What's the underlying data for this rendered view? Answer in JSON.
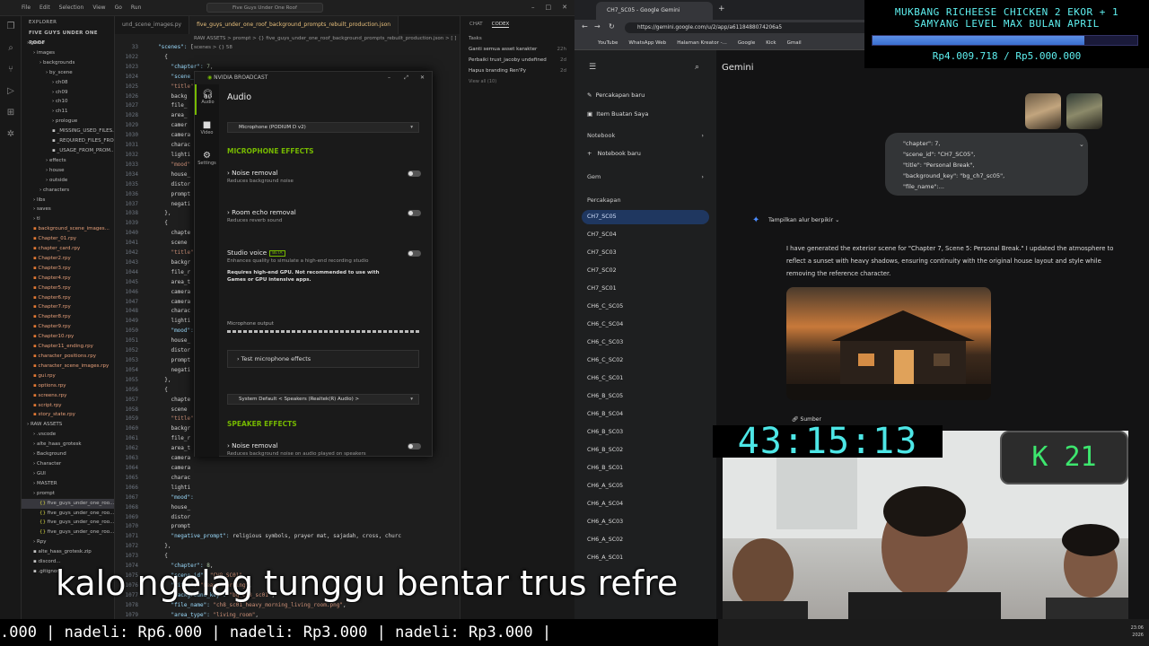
{
  "vscode": {
    "title_search": "Five Guys Under One Roof",
    "menu": [
      "File",
      "Edit",
      "Selection",
      "View",
      "Go",
      "Run"
    ],
    "explorer_header": "EXPLORER",
    "project": "FIVE GUYS UNDER ONE ROOF",
    "tree": [
      {
        "label": "game",
        "indent": 0,
        "kind": "folder"
      },
      {
        "label": "images",
        "indent": 1,
        "kind": "folder"
      },
      {
        "label": "backgrounds",
        "indent": 2,
        "kind": "folder"
      },
      {
        "label": "by_scene",
        "indent": 3,
        "kind": "folder"
      },
      {
        "label": "ch08",
        "indent": 4,
        "kind": "folder"
      },
      {
        "label": "ch09",
        "indent": 4,
        "kind": "folder"
      },
      {
        "label": "ch10",
        "indent": 4,
        "kind": "folder"
      },
      {
        "label": "ch11",
        "indent": 4,
        "kind": "folder"
      },
      {
        "label": "prologue",
        "indent": 4,
        "kind": "folder"
      },
      {
        "label": "_MISSING_USED_FILES...",
        "indent": 4,
        "kind": "file"
      },
      {
        "label": "_REQUIRED_FILES_FROM...",
        "indent": 4,
        "kind": "file"
      },
      {
        "label": "_USAGE_FROM_PROM...",
        "indent": 4,
        "kind": "file"
      },
      {
        "label": "effects",
        "indent": 3,
        "kind": "folder"
      },
      {
        "label": "house",
        "indent": 3,
        "kind": "folder"
      },
      {
        "label": "outside",
        "indent": 3,
        "kind": "folder"
      },
      {
        "label": "characters",
        "indent": 2,
        "kind": "folder"
      },
      {
        "label": "libs",
        "indent": 1,
        "kind": "folder"
      },
      {
        "label": "saves",
        "indent": 1,
        "kind": "folder"
      },
      {
        "label": "tl",
        "indent": 1,
        "kind": "folder"
      },
      {
        "label": "background_scene_images...",
        "indent": 1,
        "kind": "py"
      },
      {
        "label": "Chapter_01.rpy",
        "indent": 1,
        "kind": "py"
      },
      {
        "label": "chapter_card.rpy",
        "indent": 1,
        "kind": "py"
      },
      {
        "label": "Chapter2.rpy",
        "indent": 1,
        "kind": "py"
      },
      {
        "label": "Chapter3.rpy",
        "indent": 1,
        "kind": "py"
      },
      {
        "label": "Chapter4.rpy",
        "indent": 1,
        "kind": "py"
      },
      {
        "label": "Chapter5.rpy",
        "indent": 1,
        "kind": "py"
      },
      {
        "label": "Chapter6.rpy",
        "indent": 1,
        "kind": "py"
      },
      {
        "label": "Chapter7.rpy",
        "indent": 1,
        "kind": "py"
      },
      {
        "label": "Chapter8.rpy",
        "indent": 1,
        "kind": "py"
      },
      {
        "label": "Chapter9.rpy",
        "indent": 1,
        "kind": "py"
      },
      {
        "label": "Chapter10.rpy",
        "indent": 1,
        "kind": "py"
      },
      {
        "label": "Chapter11_ending.rpy",
        "indent": 1,
        "kind": "py"
      },
      {
        "label": "character_positions.rpy",
        "indent": 1,
        "kind": "py"
      },
      {
        "label": "character_scene_images.rpy",
        "indent": 1,
        "kind": "py"
      },
      {
        "label": "gui.rpy",
        "indent": 1,
        "kind": "py"
      },
      {
        "label": "options.rpy",
        "indent": 1,
        "kind": "py"
      },
      {
        "label": "screens.rpy",
        "indent": 1,
        "kind": "py"
      },
      {
        "label": "script.rpy",
        "indent": 1,
        "kind": "py"
      },
      {
        "label": "story_state.rpy",
        "indent": 1,
        "kind": "py"
      },
      {
        "label": "RAW ASSETS",
        "indent": 0,
        "kind": "folder"
      },
      {
        "label": ".vscode",
        "indent": 1,
        "kind": "folder"
      },
      {
        "label": "alte_haas_grotesk",
        "indent": 1,
        "kind": "folder"
      },
      {
        "label": "Background",
        "indent": 1,
        "kind": "folder"
      },
      {
        "label": "Character",
        "indent": 1,
        "kind": "folder"
      },
      {
        "label": "GUI",
        "indent": 1,
        "kind": "folder"
      },
      {
        "label": "MASTER",
        "indent": 1,
        "kind": "folder"
      },
      {
        "label": "prompt",
        "indent": 1,
        "kind": "folder"
      },
      {
        "label": "five_guys_under_one_roo...",
        "indent": 2,
        "kind": "json",
        "selected": true
      },
      {
        "label": "five_guys_under_one_roo...",
        "indent": 2,
        "kind": "json"
      },
      {
        "label": "five_guys_under_one_roo...",
        "indent": 2,
        "kind": "json"
      },
      {
        "label": "five_guys_under_one_roo...",
        "indent": 2,
        "kind": "json"
      },
      {
        "label": "Rpy",
        "indent": 1,
        "kind": "folder"
      },
      {
        "label": "alte_haas_grotesk.zip",
        "indent": 1,
        "kind": "file"
      },
      {
        "label": "discord...",
        "indent": 1,
        "kind": "file"
      },
      {
        "label": ".gitignore",
        "indent": 1,
        "kind": "file"
      }
    ],
    "tabs": [
      "und_scene_images.py",
      "five_guys_under_one_roof_background_prompts_rebuilt_production.json"
    ],
    "breadcrumb": "RAW ASSETS > prompt > {} five_guys_under_one_roof_background_prompts_rebuilt_production.json > [ ] scenes > {} 58",
    "line_numbers": [
      "33",
      "1022",
      "1023",
      "1024",
      "1025",
      "1026",
      "1027",
      "1028",
      "1029",
      "1030",
      "1031",
      "1032",
      "1033",
      "1034",
      "1035",
      "1036",
      "1037",
      "1038",
      "1039",
      "1040",
      "1041",
      "1042",
      "1043",
      "1044",
      "1045",
      "1046",
      "1047",
      "1048",
      "1049",
      "1050",
      "1051",
      "1052",
      "1053",
      "1054",
      "1055",
      "1056",
      "1057",
      "1058",
      "1059",
      "1060",
      "1061",
      "1062",
      "1063",
      "1064",
      "1065",
      "1066",
      "1067",
      "1068",
      "1069",
      "1070",
      "1071",
      "1072",
      "1073",
      "1074",
      "1075",
      "1076",
      "1077",
      "1078",
      "1079"
    ],
    "code_lines": [
      "\"scenes\": [",
      "  {",
      "    \"chapter\": 7,",
      "    \"scene_id\": \"CH7_SC05\",",
      "    \"title\"",
      "    \"backg",
      "    \"file_",
      "    \"area_",
      "    \"camer",
      "    \"camera",
      "    \"charac",
      "    \"lighti",
      "    \"mood\"",
      "    \"house_",
      "    \"distor",
      "    \"prompt",
      "    \"negati",
      "  },",
      "  {",
      "    \"chapte",
      "    \"scene",
      "    \"title\"",
      "    \"backgr",
      "    \"file_r",
      "    \"area_t",
      "    \"camera",
      "    \"camera",
      "    \"charac",
      "    \"lighti",
      "    \"mood\":",
      "    \"house_",
      "    \"distor",
      "    \"prompt",
      "    \"negati",
      "  },",
      "  {",
      "    \"chapte",
      "    \"scene",
      "    \"title\"",
      "    \"backgr",
      "    \"file_r",
      "    \"area_t",
      "    \"camera",
      "    \"camera",
      "    \"charac",
      "    \"lighti",
      "    \"mood\":",
      "    \"house_",
      "    \"distor",
      "    \"prompt",
      "    \"negative_prompt\": \"religious symbols, prayer mat, sajadah, cross, churc",
      "  },",
      "  {",
      "    \"chapter\": 8,",
      "    \"scene_id\": \"CH8_SC01\",",
      "    \"title\": \"Heavy Morning\",",
      "    \"background_key\": \"bg_ch8_sc01\",",
      "    \"file_name\": \"ch8_sc01_heavy_morning_living_room.png\",",
      "    \"area_type\": \"living_room\","
    ],
    "code_tail": [
      "    \"camera_preset\": \"wide_group\",",
      "    \"camera_description\": \"wide shot, eye level, showing full room layout, e",
      "    \"character_blocking_and_movement\": \"all characters present but emotional",
      "    \"lighting\": \"dim morning light\","
    ],
    "chat_tabs": [
      "CHAT",
      "CODEX"
    ],
    "tasks_header": "Tasks",
    "tasks": [
      {
        "label": "Ganti semua asset karakter",
        "time": "22h"
      },
      {
        "label": "Perbaiki trust_jacoby undefined",
        "time": "2d"
      },
      {
        "label": "Hapus branding Ren'Py",
        "time": "2d"
      }
    ],
    "view_all": "View all (10)"
  },
  "nvidia": {
    "window_title": "NVIDIA BROADCAST",
    "side": [
      {
        "icon": "headset-icon",
        "label": "Audio"
      },
      {
        "icon": "camera-icon",
        "label": "Video"
      },
      {
        "icon": "gear-icon",
        "label": "Settings"
      }
    ],
    "heading": "Audio",
    "mic_device": "Microphone (PODIUM D v2)",
    "mic_section": "MICROPHONE EFFECTS",
    "mic_effects": [
      {
        "title": "Noise removal",
        "desc": "Reduces background noise",
        "on": false
      },
      {
        "title": "Room echo removal",
        "desc": "Reduces reverb sound",
        "on": false
      },
      {
        "title": "Studio voice",
        "desc": "Enhances quality to simulate a high-end recording studio",
        "badge": "BETA",
        "on": false
      }
    ],
    "studio_warning": "Requires high-end GPU. Not recommended to use with Games or GPU intensive apps.",
    "mic_output": "Microphone output",
    "test_button": "Test microphone effects",
    "speaker_device": "System Default < Speakers (Realtek(R) Audio) >",
    "speaker_section": "SPEAKER EFFECTS",
    "speaker_effects": [
      {
        "title": "Noise removal",
        "desc": "Reduces background noise on audio played on speakers",
        "on": false
      }
    ]
  },
  "chrome": {
    "tab_title": "CH7_SC05 - Google Gemini",
    "url": "https://gemini.google.com/u/2/app/a6118488074206a5",
    "bookmarks": [
      "YouTube",
      "WhatsApp Web",
      "Halaman Kreator -...",
      "Google",
      "Kick",
      "Gmail"
    ]
  },
  "gemini": {
    "brand": "Gemini",
    "new_chat": "Percakapan baru",
    "my_items": "Item Buatan Saya",
    "notebook": "Notebook",
    "new_notebook": "Notebook baru",
    "gem": "Gem",
    "conversations": "Percakapan",
    "recent": [
      "CH7_SC05",
      "CH7_SC04",
      "CH7_SC03",
      "CH7_SC02",
      "CH7_SC01",
      "CH6_C_SC05",
      "CH6_C_SC04",
      "CH6_C_SC03",
      "CH6_C_SC02",
      "CH6_C_SC01",
      "CH6_B_SC05",
      "CH6_B_SC04",
      "CH6_B_SC03",
      "CH6_B_SC02",
      "CH6_B_SC01",
      "CH6_A_SC05",
      "CH6_A_SC04",
      "CH6_A_SC03",
      "CH6_A_SC02",
      "CH6_A_SC01"
    ],
    "prompt_preview": "\"chapter\": 7,\n\"scene_id\": \"CH7_SC05\",\n\"title\": \"Personal Break\",\n\"background_key\": \"bg_ch7_sc05\",\n\"file_name\":...",
    "show_thinking": "Tampilkan alur berpikir",
    "reply": "I have generated the exterior scene for \"Chapter 7, Scene 5: Personal Break.\" I updated the atmosphere to reflect a sunset with heavy shadows, ensuring continuity with the original house layout and style while removing the reference character.",
    "sources": "Sumber"
  },
  "overlay": {
    "goal_line1": "MUKBANG RICHEESE CHICKEN 2 EKOR + 1",
    "goal_line2": "SAMYANG LEVEL MAX BULAN APRIL",
    "goal_amount": "Rp4.009.718 / Rp5.000.000",
    "goal_progress": 0.8,
    "timer": "43:15:13",
    "k_badge": "21",
    "subtitle": "kalo ngelag tunggu bentar trus refre",
    "ticker": ".000 | nadeli: Rp6.000 | nadeli: Rp3.000 | nadeli: Rp3.000 |",
    "clock_time": "23:06",
    "clock_date": "2026"
  },
  "colors": {
    "nvidia_green": "#76b900",
    "goal_cyan": "#5ef0f0",
    "timer_cyan": "#4de6e6",
    "k_green": "#3de66e",
    "gemini_active": "#1f3760"
  }
}
